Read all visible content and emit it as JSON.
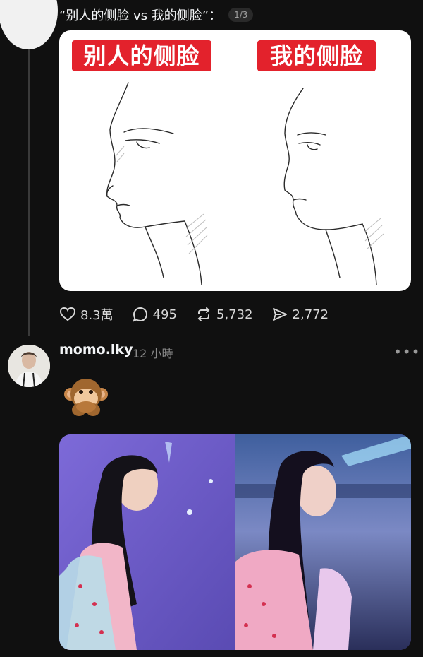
{
  "post": {
    "caption": "“别人的侧脸 vs 我的侧脸”：",
    "page_indicator": "1/3",
    "image_labels": {
      "left": "别人的侧脸",
      "right": "我的侧脸"
    },
    "stats": {
      "likes": "8.3萬",
      "comments": "495",
      "reposts": "5,732",
      "shares": "2,772"
    }
  },
  "reply": {
    "username": "momo.lky",
    "time": "12 小時",
    "more_icon": "more-icon"
  },
  "icons": [
    "heart-icon",
    "comment-icon",
    "repost-icon",
    "share-icon",
    "monkey-emoji-icon"
  ],
  "colors": {
    "background": "#101010",
    "label_red": "#e3222c",
    "text": "#f3f5f7",
    "muted": "#8a8a8a"
  }
}
